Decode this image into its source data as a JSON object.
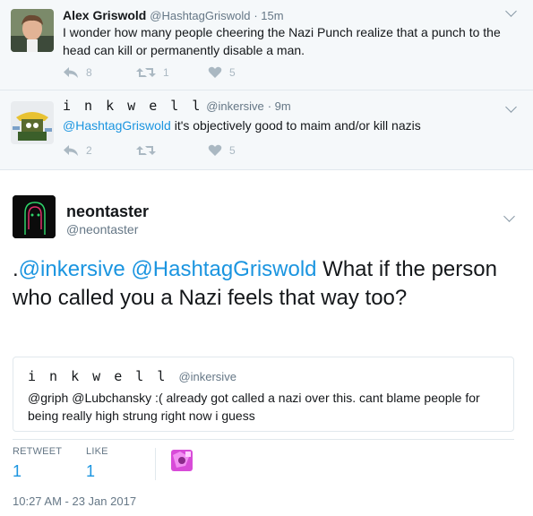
{
  "replies": [
    {
      "name": "Alex Griswold",
      "handle": "@HashtagGriswold",
      "time": "· 15m",
      "text": "I wonder how many people cheering the Nazi Punch realize that a punch to the head can kill or permanently disable a man.",
      "reply_count": "8",
      "retweet_count": "1",
      "like_count": "5"
    },
    {
      "name": "i n k w e l l",
      "handle": "@inkersive",
      "time": "· 9m",
      "mention": "@HashtagGriswold",
      "text": " it's objectively good to maim and/or kill nazis",
      "reply_count": "2",
      "retweet_count": "",
      "like_count": "5"
    }
  ],
  "main_tweet": {
    "name": "neontaster",
    "handle": "@neontaster",
    "prefix": ".",
    "mention1": "@inkersive",
    "mention2": "@HashtagGriswold",
    "text": " What if the person who called you a Nazi feels that way too?",
    "quote": {
      "name": "i n k w e l l",
      "handle": "@inkersive",
      "text": "@griph @Lubchansky :( already got called a nazi over this. cant blame people for being really high strung right now i guess"
    },
    "stats": {
      "retweet_label": "RETWEET",
      "retweet_count": "1",
      "like_label": "LIKE",
      "like_count": "1"
    },
    "timestamp": "10:27 AM - 23 Jan 2017"
  },
  "colors": {
    "link": "#1b95e0",
    "muted": "#657786",
    "icon": "#aab8c2",
    "reply_bg": "#f5f8fa"
  },
  "icons": [
    "reply-icon",
    "retweet-icon",
    "heart-icon",
    "chevron-down-icon"
  ]
}
